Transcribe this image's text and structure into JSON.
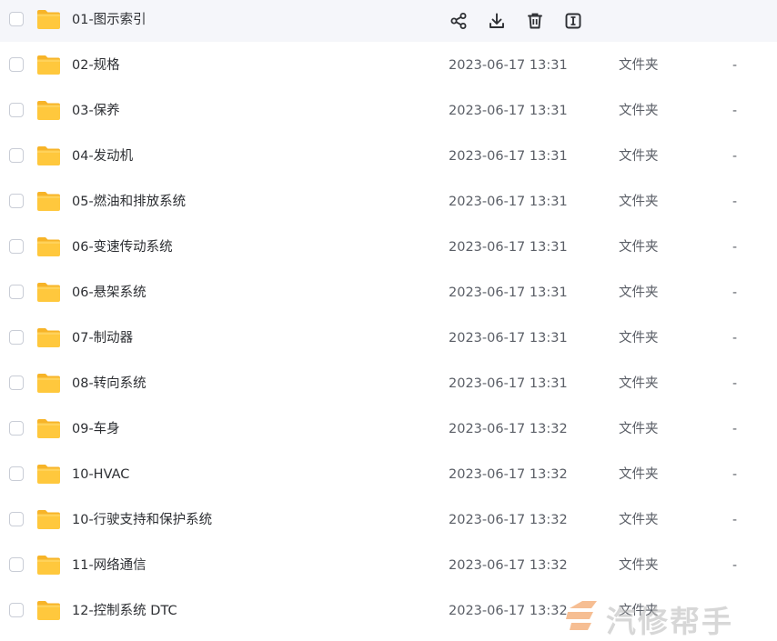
{
  "hover_actions": [
    {
      "name": "share-icon",
      "label": "share"
    },
    {
      "name": "download-icon",
      "label": "download"
    },
    {
      "name": "delete-icon",
      "label": "delete"
    },
    {
      "name": "rename-icon",
      "label": "rename"
    }
  ],
  "files": [
    {
      "name": "01-图示索引",
      "date": "",
      "type": "",
      "size": ""
    },
    {
      "name": "02-规格",
      "date": "2023-06-17 13:31",
      "type": "文件夹",
      "size": "-"
    },
    {
      "name": "03-保养",
      "date": "2023-06-17 13:31",
      "type": "文件夹",
      "size": "-"
    },
    {
      "name": "04-发动机",
      "date": "2023-06-17 13:31",
      "type": "文件夹",
      "size": "-"
    },
    {
      "name": "05-燃油和排放系统",
      "date": "2023-06-17 13:31",
      "type": "文件夹",
      "size": "-"
    },
    {
      "name": "06-变速传动系统",
      "date": "2023-06-17 13:31",
      "type": "文件夹",
      "size": "-"
    },
    {
      "name": "06-悬架系统",
      "date": "2023-06-17 13:31",
      "type": "文件夹",
      "size": "-"
    },
    {
      "name": "07-制动器",
      "date": "2023-06-17 13:31",
      "type": "文件夹",
      "size": "-"
    },
    {
      "name": "08-转向系统",
      "date": "2023-06-17 13:31",
      "type": "文件夹",
      "size": "-"
    },
    {
      "name": "09-车身",
      "date": "2023-06-17 13:32",
      "type": "文件夹",
      "size": "-"
    },
    {
      "name": "10-HVAC",
      "date": "2023-06-17 13:32",
      "type": "文件夹",
      "size": "-"
    },
    {
      "name": "10-行驶支持和保护系统",
      "date": "2023-06-17 13:32",
      "type": "文件夹",
      "size": "-"
    },
    {
      "name": "11-网络通信",
      "date": "2023-06-17 13:32",
      "type": "文件夹",
      "size": "-"
    },
    {
      "name": "12-控制系统 DTC",
      "date": "2023-06-17 13:32",
      "type": "文件夹",
      "size": ""
    }
  ],
  "watermark": {
    "text": "汽修帮手"
  },
  "colors": {
    "folder": "#ffc83d",
    "folder_back": "#f5a623",
    "icon": "#2d2f33",
    "hover_bg": "#f5f6fa"
  }
}
